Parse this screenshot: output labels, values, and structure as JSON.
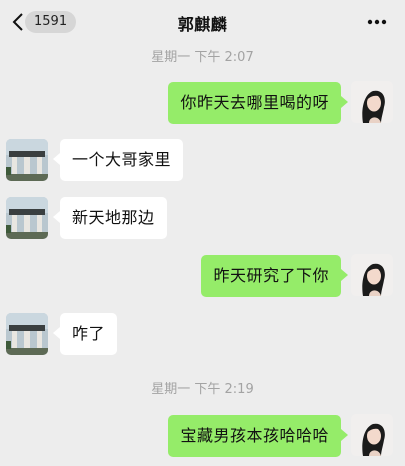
{
  "header": {
    "unread_count": "1591",
    "title": "郭麒麟",
    "back_icon": "chevron-left-icon",
    "more_icon": "ellipsis-icon"
  },
  "timestamps": [
    "星期一 下午 2:07",
    "星期一 下午 2:19"
  ],
  "messages": [
    {
      "sender": "self",
      "text": "你昨天去哪里喝的呀"
    },
    {
      "sender": "other",
      "text": "一个大哥家里"
    },
    {
      "sender": "other",
      "text": "新天地那边"
    },
    {
      "sender": "self",
      "text": "昨天研究了下你"
    },
    {
      "sender": "other",
      "text": "咋了"
    },
    {
      "sender": "self",
      "text": "宝藏男孩本孩哈哈哈"
    }
  ],
  "colors": {
    "background": "#ededed",
    "self_bubble": "#95ec69",
    "other_bubble": "#ffffff",
    "timestamp_text": "#a3a3a3"
  }
}
